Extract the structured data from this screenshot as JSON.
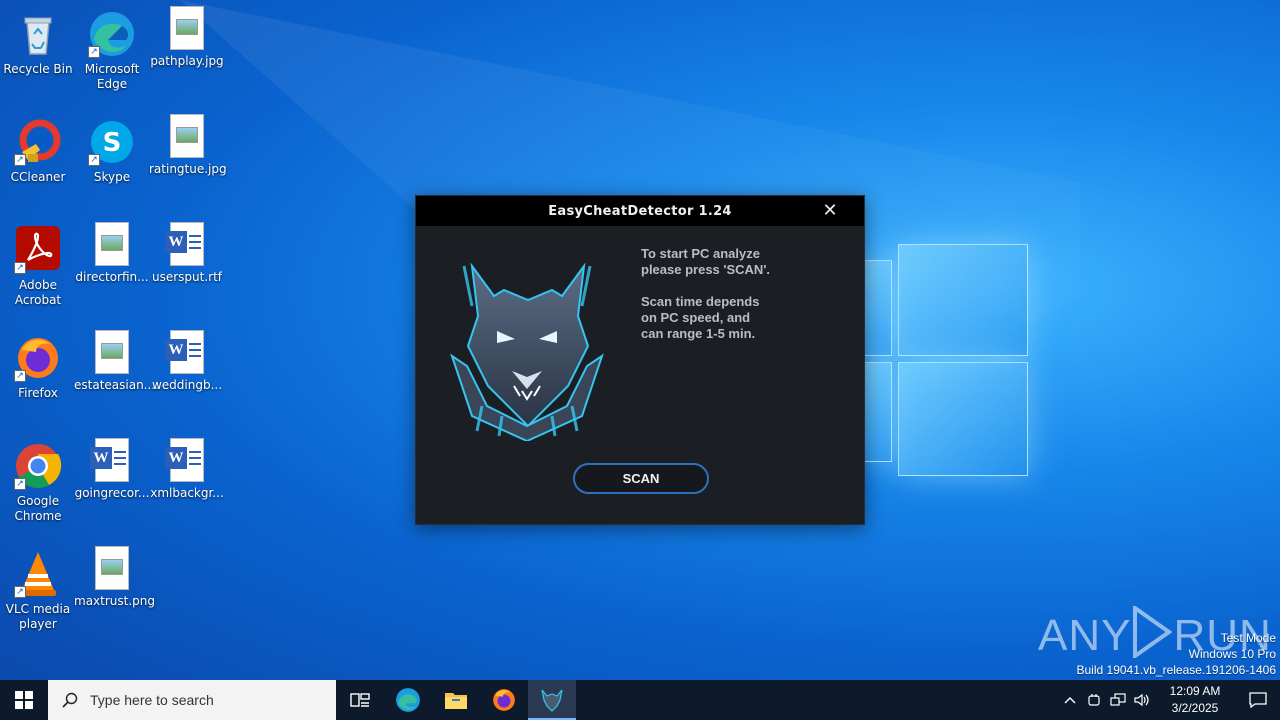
{
  "desktop": {
    "icons": [
      {
        "label": "Recycle Bin",
        "icon": "recycle-bin-icon"
      },
      {
        "label": "Microsoft Edge",
        "icon": "edge-icon"
      },
      {
        "label": "pathplay.jpg",
        "icon": "image-file-icon"
      },
      {
        "label": "CCleaner",
        "icon": "ccleaner-icon"
      },
      {
        "label": "Skype",
        "icon": "skype-icon"
      },
      {
        "label": "ratingtue.jpg",
        "icon": "image-file-icon"
      },
      {
        "label": "Adobe Acrobat",
        "icon": "acrobat-icon"
      },
      {
        "label": "directorfin...",
        "icon": "image-file-icon"
      },
      {
        "label": "usersput.rtf",
        "icon": "word-file-icon"
      },
      {
        "label": "Firefox",
        "icon": "firefox-icon"
      },
      {
        "label": "estateasian....",
        "icon": "image-file-icon"
      },
      {
        "label": "weddingb...",
        "icon": "word-file-icon"
      },
      {
        "label": "Google Chrome",
        "icon": "chrome-icon"
      },
      {
        "label": "goingrecor...",
        "icon": "word-file-icon"
      },
      {
        "label": "xmlbackgr...",
        "icon": "word-file-icon"
      },
      {
        "label": "VLC media player",
        "icon": "vlc-icon"
      },
      {
        "label": "maxtrust.png",
        "icon": "image-file-icon"
      }
    ]
  },
  "dialog": {
    "title": "EasyCheatDetector 1.24",
    "message": "To start PC analyze\nplease press 'SCAN'.\n\nScan time depends\non PC speed, and\ncan range 1-5 min.",
    "scan_label": "SCAN",
    "close_glyph": "✕"
  },
  "watermark": {
    "brand_left": "ANY",
    "brand_right": "RUN",
    "mode": "Test Mode",
    "edition": "Windows 10 Pro",
    "build": "Build 19041.vb_release.191206-1406"
  },
  "taskbar": {
    "search_placeholder": "Type here to search",
    "time": "12:09 AM",
    "date": "3/2/2025"
  },
  "colors": {
    "dialog_bg": "#1b1f24",
    "scan_border": "#2f6fc0",
    "taskbar_bg": "#0c1a2b"
  }
}
